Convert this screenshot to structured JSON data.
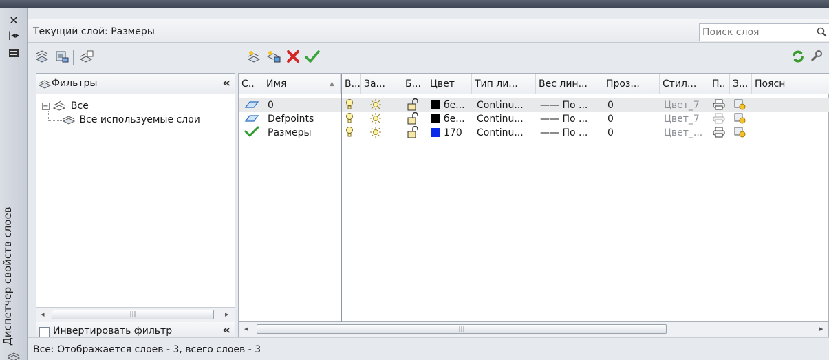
{
  "side": {
    "vertical_title": "Диспетчер свойств слоев"
  },
  "header": {
    "current_layer_label": "Текущий слой: Размеры",
    "search_placeholder": "Поиск слоя"
  },
  "filters": {
    "title": "Фильтры",
    "tree": [
      {
        "label": "Все"
      },
      {
        "label": "Все используемые слои"
      }
    ],
    "invert_label": "Инвертировать фильтр",
    "invert_checked": false
  },
  "grid": {
    "columns": [
      "С..",
      "Имя",
      "В...",
      "За...",
      "Б...",
      "Цвет",
      "Тип ли...",
      "Вес лин...",
      "Проз...",
      "Стил...",
      "П..",
      "З...",
      "Поясн"
    ],
    "rows": [
      {
        "name": "0",
        "color_label": "бе...",
        "color": "#000000",
        "linetype": "Continu...",
        "lineweight": "—— По ...",
        "transparency": "0",
        "plot_style": "Цвет_7",
        "plot_enabled": true,
        "current": false,
        "selected": true
      },
      {
        "name": "Defpoints",
        "color_label": "бе...",
        "color": "#000000",
        "linetype": "Continu...",
        "lineweight": "—— По ...",
        "transparency": "0",
        "plot_style": "Цвет_7",
        "plot_enabled": false,
        "current": false,
        "selected": false
      },
      {
        "name": "Размеры",
        "color_label": "170",
        "color": "#0b2bea",
        "linetype": "Continu...",
        "lineweight": "—— По ...",
        "transparency": "0",
        "plot_style": "Цвет_...",
        "plot_enabled": true,
        "current": true,
        "selected": false
      }
    ]
  },
  "status": {
    "text": "Все: Отображается слоев - 3, всего слоев - 3"
  },
  "colors": {
    "accent_green": "#3aa23a",
    "delete_red": "#d42626",
    "current_check": "#2f9e2f"
  },
  "icons": [
    "close-icon",
    "auto-hide-icon",
    "properties-icon",
    "new-filter-icon",
    "new-group-filter-icon",
    "states-manager-icon",
    "new-layer-icon",
    "new-layer-frozen-icon",
    "delete-layer-icon",
    "set-current-icon",
    "search-icon",
    "refresh-icon",
    "settings-icon"
  ]
}
